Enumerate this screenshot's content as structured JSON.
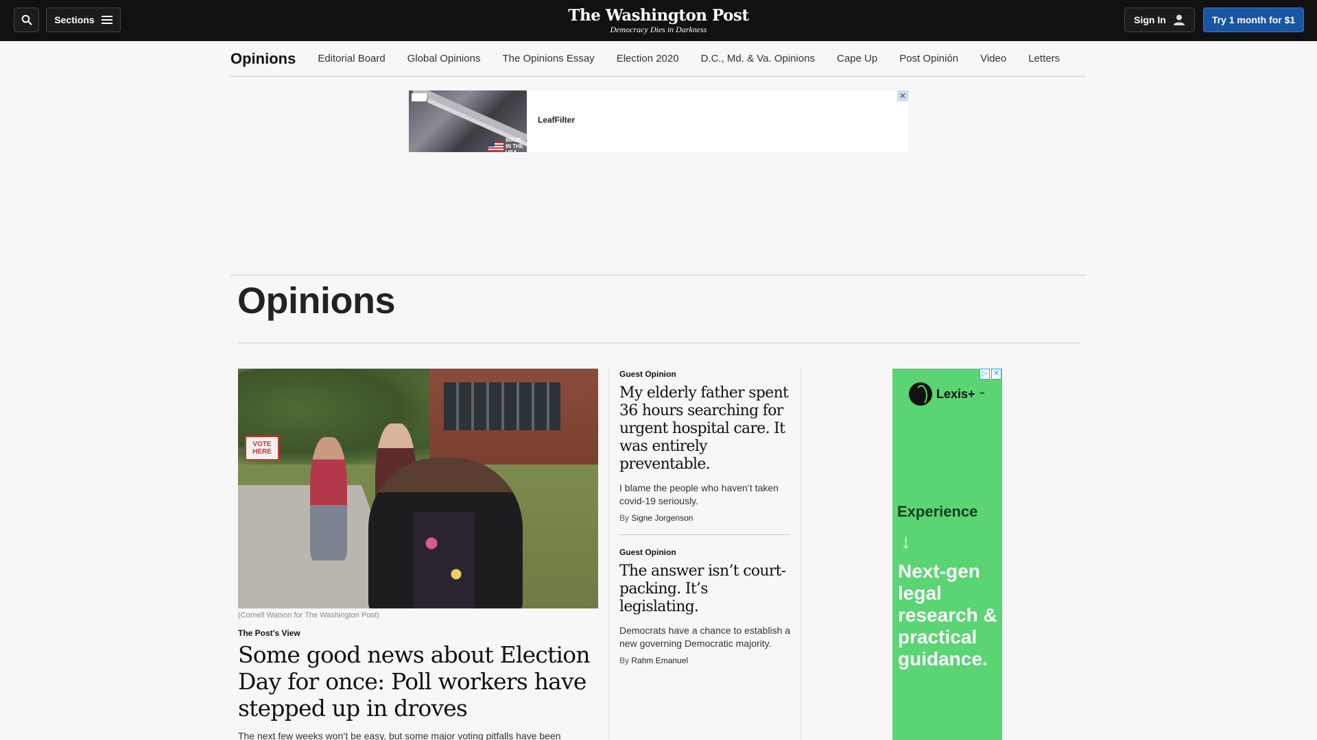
{
  "header": {
    "search_icon": "search-icon",
    "sections_label": "Sections",
    "logo_name": "The Washington Post",
    "logo_tagline": "Democracy Dies in Darkness",
    "signin_label": "Sign In",
    "trial_label": "Try 1 month for $1"
  },
  "subnav": {
    "title": "Opinions",
    "items": [
      "Editorial Board",
      "Global Opinions",
      "The Opinions Essay",
      "Election 2020",
      "D.C., Md. & Va. Opinions",
      "Cape Up",
      "Post Opinión",
      "Video",
      "Letters"
    ]
  },
  "top_ad": {
    "badge": "MADE IN THE USA",
    "brand": "LeafFilter",
    "close": "✕"
  },
  "page": {
    "title": "Opinions"
  },
  "lead": {
    "photo_credit": "(Cornell Watson for The Washington Post)",
    "sign_text": "VOTE HERE",
    "kicker": "The Post's View",
    "headline": "Some good news about Election Day for once: Poll workers have stepped up in droves",
    "blurb": "The next few weeks won’t be easy, but some major voting pitfalls have been"
  },
  "stories": [
    {
      "kicker": "Guest Opinion",
      "headline": "My elderly father spent 36 hours searching for urgent hospital care. It was entirely preventable.",
      "blurb": "I blame the people who haven’t taken covid-19 seriously.",
      "by": "By",
      "author": "Signe Jorgenson"
    },
    {
      "kicker": "Guest Opinion",
      "headline": "The answer isn’t court-packing. It’s legislating.",
      "blurb": "Democrats have a chance to establish a new governing Democratic majority.",
      "by": "By",
      "author": "Rahm Emanuel"
    }
  ],
  "side_ad": {
    "brand": "Lexis+",
    "brand_mark": "™",
    "experience": "Experience",
    "arrow": "↓",
    "copy": "Next-gen legal research & practical guidance.",
    "adchoices": "▷",
    "close": "✕"
  },
  "colors": {
    "topbar": "#111111",
    "trial_button": "#1955a5",
    "side_ad_green": "#5bd474"
  }
}
